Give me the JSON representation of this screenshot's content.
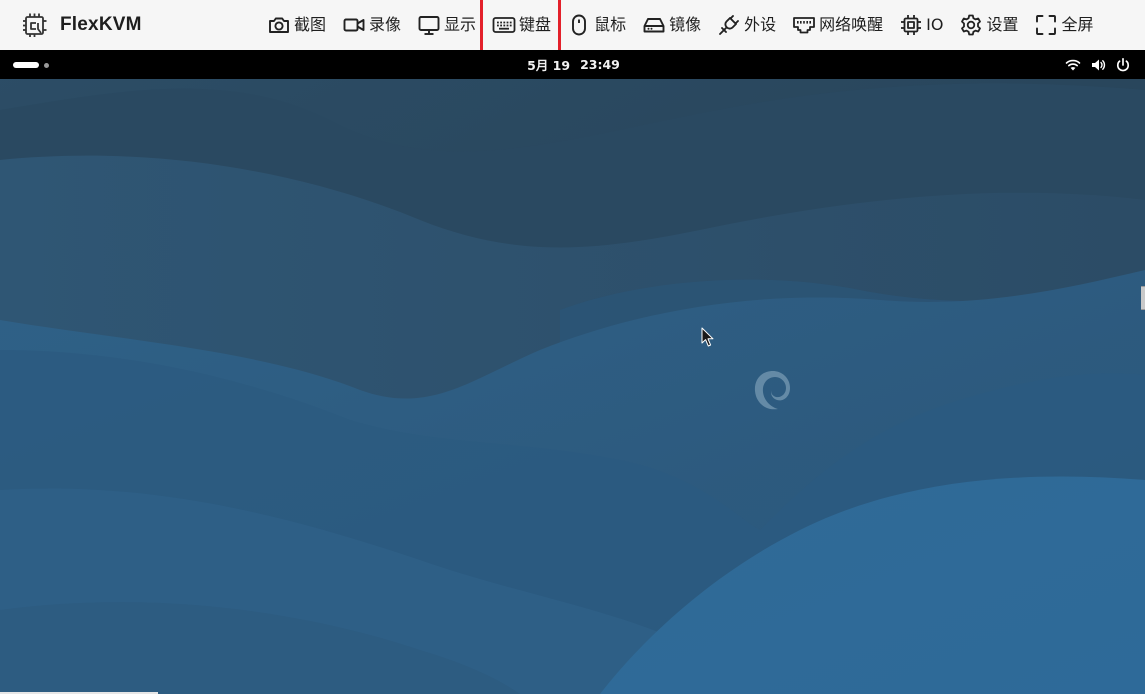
{
  "app": {
    "name": "FlexKVM"
  },
  "toolbar": {
    "items": [
      {
        "label": "截图",
        "icon": "camera-icon",
        "selected": false
      },
      {
        "label": "录像",
        "icon": "video-camera-icon",
        "selected": false
      },
      {
        "label": "显示",
        "icon": "monitor-icon",
        "selected": false
      },
      {
        "label": "键盘",
        "icon": "keyboard-icon",
        "selected": true
      },
      {
        "label": "鼠标",
        "icon": "mouse-icon",
        "selected": false
      },
      {
        "label": "镜像",
        "icon": "hard-drive-icon",
        "selected": false
      },
      {
        "label": "外设",
        "icon": "plug-icon",
        "selected": false
      },
      {
        "label": "网络唤醒",
        "icon": "ethernet-port-icon",
        "selected": false
      },
      {
        "label": "IO",
        "icon": "chip-icon",
        "selected": false
      },
      {
        "label": "设置",
        "icon": "gear-icon",
        "selected": false
      },
      {
        "label": "全屏",
        "icon": "fullscreen-icon",
        "selected": false
      }
    ],
    "highlight_color": "#e3202a"
  },
  "remote": {
    "topbar": {
      "date": "5月 19",
      "time": "23:49",
      "tray_icons": [
        "wifi-icon",
        "volume-icon",
        "power-icon"
      ]
    },
    "wallpaper": "debian-waves",
    "colors": {
      "topbar": "#000000",
      "wallpaper_dark": "#2a4a63",
      "wallpaper_light": "#2e6a96"
    }
  }
}
